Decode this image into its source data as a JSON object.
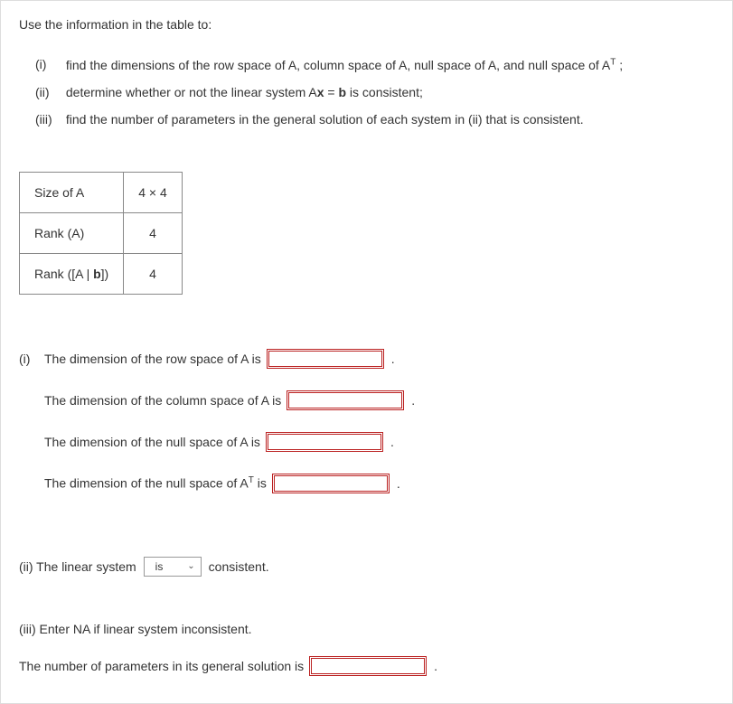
{
  "intro": "Use the information in the table to:",
  "tasks": {
    "i": {
      "num": "(i)",
      "text_a": "find the dimensions of the row space of A, column space of A, null space of A, and null space of A",
      "sup": "T",
      "text_b": " ;"
    },
    "ii": {
      "num": "(ii)",
      "text_a": "determine whether or not the linear system A",
      "bold1": "x",
      "text_b": " = ",
      "bold2": "b",
      "text_c": " is consistent;"
    },
    "iii": {
      "num": "(iii)",
      "text": "find the number of parameters in the general solution of each system in (ii) that is consistent."
    }
  },
  "table": {
    "r1": {
      "label": "Size of A",
      "value": "4 × 4"
    },
    "r2": {
      "label": "Rank (A)",
      "value": "4"
    },
    "r3": {
      "label_a": "Rank ([A | ",
      "bold": "b",
      "label_b": "])",
      "value": "4"
    }
  },
  "answers_i": {
    "lead": "(i)",
    "row1": "The dimension of the row space of A is",
    "row2": "The dimension of the column space of A is",
    "row3": "The dimension of the null space of A is",
    "row4_a": "The dimension of the null space of A",
    "row4_sup": "T",
    "row4_b": " is"
  },
  "part_ii": {
    "lead": "(ii) The linear system",
    "select_value": "is",
    "trail": "consistent."
  },
  "part_iii": {
    "note": "(iii) Enter NA if linear system inconsistent.",
    "label": "The number of parameters in its general solution is"
  },
  "period": "."
}
